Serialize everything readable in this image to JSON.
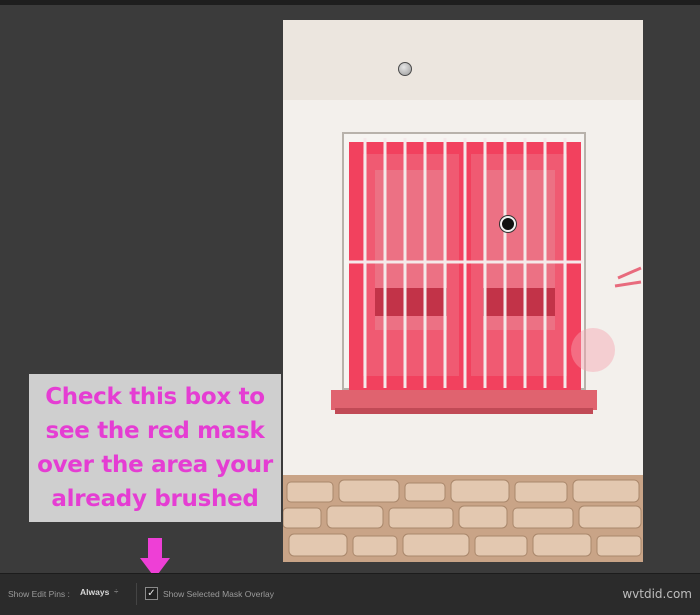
{
  "callout": {
    "lines": [
      "Check this box to",
      "see the red mask",
      "over the area your",
      "already brushed"
    ]
  },
  "toolbar": {
    "edit_pins_label": "Show Edit Pins :",
    "edit_pins_value": "Always",
    "edit_pins_arrow": "÷",
    "mask_overlay_label": "Show Selected Mask Overlay",
    "mask_overlay_checked": true,
    "check_glyph": "✓"
  },
  "watermark": "wvtdid.com",
  "colors": {
    "callout_text": "#e53dd3",
    "callout_bg": "#cfcfcf",
    "mask_red": "#f2415e",
    "arrow": "#ee3fd6"
  },
  "icons": {
    "edit_pin_inactive": "grey-pin-icon",
    "edit_pin_active": "black-pin-icon",
    "callout_arrow": "arrow-down-icon"
  }
}
